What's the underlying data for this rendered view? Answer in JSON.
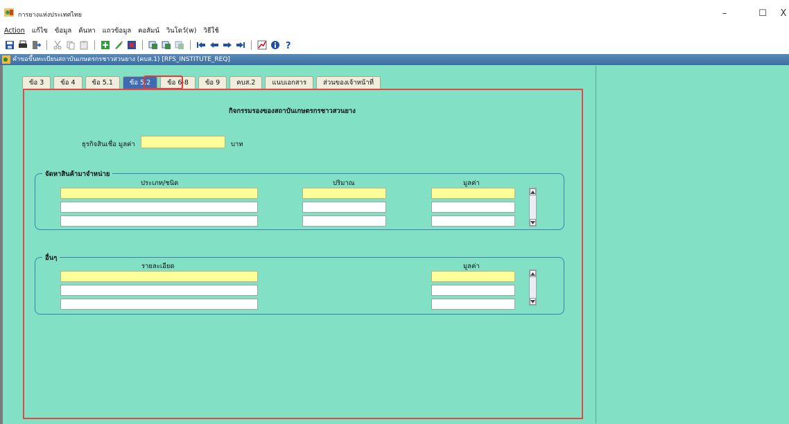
{
  "window": {
    "title": "การยางแห่งประเทศไทย",
    "controls": {
      "minimize": "–",
      "maximize": "☐",
      "close": "X"
    }
  },
  "menu": [
    "Action",
    "แก้ไข",
    "ข้อมูล",
    "ค้นหา",
    "แถวข้อมูล",
    "คอลัมน์",
    "วินโดว์(w)",
    "วิธีใช้"
  ],
  "toolbar": {
    "icons": [
      "save-icon",
      "print-icon",
      "exit-icon",
      "cut-icon",
      "copy-icon",
      "paste-icon",
      "insert-record-icon",
      "edit-record-icon",
      "delete-record-icon",
      "query-icon",
      "execute-query-icon",
      "cancel-query-icon",
      "first-record-icon",
      "previous-record-icon",
      "next-record-icon",
      "last-record-icon",
      "chart-icon",
      "info-icon",
      "help-icon"
    ]
  },
  "form_caption": "คำขอขึ้นทะเบียนสถาบันเกษตรกรชาวสวนยาง (คบส.1) [RFS_INSTITUTE_REQ]",
  "tabs": [
    {
      "label": "ข้อ 3"
    },
    {
      "label": "ข้อ 4"
    },
    {
      "label": "ข้อ 5.1"
    },
    {
      "label": "ข้อ 5.2",
      "active": true
    },
    {
      "label": "ข้อ 6-8"
    },
    {
      "label": "ข้อ 9"
    },
    {
      "label": "คบส.2"
    },
    {
      "label": "แนบเอกสาร"
    },
    {
      "label": "ส่วนของเจ้าหน้าที่"
    }
  ],
  "section_title": "กิจกรรมรองของสถาบันเกษตรกรชาวสวนยาง",
  "credit": {
    "label": "ธุรกิจสินเชื่อ มูลค่า",
    "value": "",
    "unit": "บาท"
  },
  "procurement": {
    "title": "จัดหาสินค้ามาจำหน่าย",
    "col_type": "ประเภท/ชนิด",
    "col_qty": "ปริมาณ",
    "col_value": "มูลค่า",
    "rows": [
      {
        "type": "",
        "qty": "",
        "value": ""
      },
      {
        "type": "",
        "qty": "",
        "value": ""
      },
      {
        "type": "",
        "qty": "",
        "value": ""
      }
    ]
  },
  "other": {
    "title": "อื่นๆ",
    "col_detail": "รายละเอียด",
    "col_value": "มูลค่า",
    "rows": [
      {
        "detail": "",
        "value": ""
      },
      {
        "detail": "",
        "value": ""
      },
      {
        "detail": "",
        "value": ""
      }
    ]
  },
  "colors": {
    "workspace": "#82e0c4",
    "active_tab": "#3e6cb2",
    "highlight": "#e53935",
    "current_field": "#ffff99"
  }
}
